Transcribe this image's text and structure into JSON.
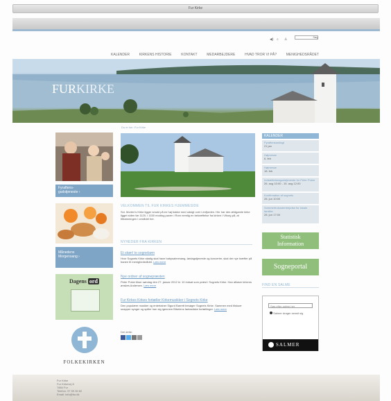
{
  "window": {
    "title": "Fur Kirke"
  },
  "utility": {
    "search_button": "Søg"
  },
  "nav": {
    "items": [
      "KALENDER",
      "KIRKENS HISTORIE",
      "KONTAKT",
      "MEDARBEJDERE",
      "HVAD TROR VI PÅ?",
      "MENIGHEDSRÅDET"
    ]
  },
  "banner": {
    "title_fur": "FUR",
    "title_kirke": "KIRKE"
  },
  "breadcrumb": "Du er her: Fur Kirke",
  "left": {
    "box1_caption_line1": "Fyraftens-",
    "box1_caption_line2": "gudstjeneste ›",
    "box2_caption_line1": "Månedens",
    "box2_caption_line2": "Morgensang ›",
    "dagens_ord_title": "Dagens",
    "dagens_ord_title2": "ord",
    "logo_text": "FOLKEKIRKEN"
  },
  "main": {
    "welcome_title": "VELKOMMEN TIL FUR KIRKES HJEMMESIDE",
    "welcome_text": "Sct. Morten's Kirke ligger smukt på en høj bakke med udsigt over Limfjorden. Her har den ældgamle kirke ligget siden før 1120. I 1150 modtog paven i Rom nemlig en bekræftelse fra kirken i Viborg på, at tiltrømningen i området her.",
    "news_title": "NYHEDER FRA KIRKEN",
    "news": [
      {
        "title": "Et skøn! to sognebørn",
        "text": "Hvor Sognets Kirke stadig skal have babysalmesang, lørdagstjeneste og koncerter, skal der nye kræfter på banen til menighedsrådet.",
        "more": "Læs mere"
      },
      {
        "title": "Nye ordner af sognepræsten",
        "text": "Peter Poker tilser søndag den 27. januar 2012 kl. 10 indsat som præst i Sognets Kirke. Han afløser kirkens ønskes Andersen.",
        "more": "Læs mere"
      },
      {
        "title": "Fur Kirkes Kirkes fortæller Kirkemusikker i Sognets Kirke",
        "text": "Den populære musiker og entertainer Sigurd Barrett besøger Sognets Kirke. Sammen med tilskuer snapper synger og spiller han sig igennem Bibelens fantastiske fortællinger.",
        "more": "Læs mere"
      }
    ],
    "share_label": "Del dette:"
  },
  "right": {
    "calendar_header": "KALENDER",
    "calendar": [
      {
        "t": "Fyraftensandagt",
        "d": "21 jan"
      },
      {
        "t": "Højmesse",
        "d": "6. feb"
      },
      {
        "t": "Højmesse",
        "d": "18. feb"
      },
      {
        "t": "Indsættelsesgudstjeneste for Peter Poker",
        "d": "26. aug 10:00 - 15. aug 12:00"
      },
      {
        "t": "Konfirmation af sognets",
        "d": "28. jun 10:00"
      },
      {
        "t": "Sommerfrokostentreprise for lokale familier",
        "d": "28. jun 17:00"
      }
    ],
    "btn1_line1": "Statistisk",
    "btn1_line2": "Information",
    "btn2": "Sogneportal",
    "salmer_title": "FIND EN SALME",
    "salmer_input_placeholder": "Søg efter salme her",
    "salmer_option": "Salmer drager sensit sig",
    "salmer_logo": "SALMER"
  },
  "footer": {
    "lines": [
      "Fur Kirke",
      "Fur Kirkevej 8",
      "7884 Fur",
      "Telefon: 97 59 30 82",
      "Email: info@fur.dk"
    ]
  },
  "colors": {
    "accent_blue": "#8fb6d4",
    "accent_green": "#8fbf7a"
  }
}
